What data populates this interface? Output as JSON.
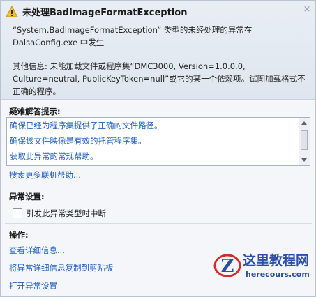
{
  "dialog": {
    "title": "未处理BadImageFormatException",
    "close_glyph": "×",
    "message_line1": "“System.BadImageFormatException” 类型的未经处理的异常在 DalsaConfig.exe 中发生",
    "message_line2": "其他信息: 未能加载文件或程序集“DMC3000, Version=1.0.0.0, Culture=neutral, PublicKeyToken=null”或它的某一个依赖项。试图加载格式不正确的程序。"
  },
  "troubleshooting": {
    "title": "疑难解答提示:",
    "tips": [
      "确保已经为程序集提供了正确的文件路径。",
      "确保该文件映像是有效的托管程序集。",
      "获取此异常的常规帮助。"
    ],
    "search_link": "搜索更多联机帮助..."
  },
  "exception_settings": {
    "title": "异常设置:",
    "checkbox_label": "引发此异常类型时中断"
  },
  "actions": {
    "title": "操作:",
    "items": [
      "查看详细信息...",
      "将异常详细信息复制到剪贴板",
      "打开异常设置"
    ]
  },
  "watermark": {
    "title": "这里教程网",
    "url": "herecours.com",
    "logo_letter": "Z"
  },
  "icons": {
    "warning": "warning-icon",
    "close": "close-icon",
    "scroll_up": "chevron-up-icon",
    "scroll_down": "chevron-down-icon"
  },
  "colors": {
    "link": "#1f5fbf",
    "warning": "#f2c12e",
    "watermark": "#2b4ea8"
  }
}
